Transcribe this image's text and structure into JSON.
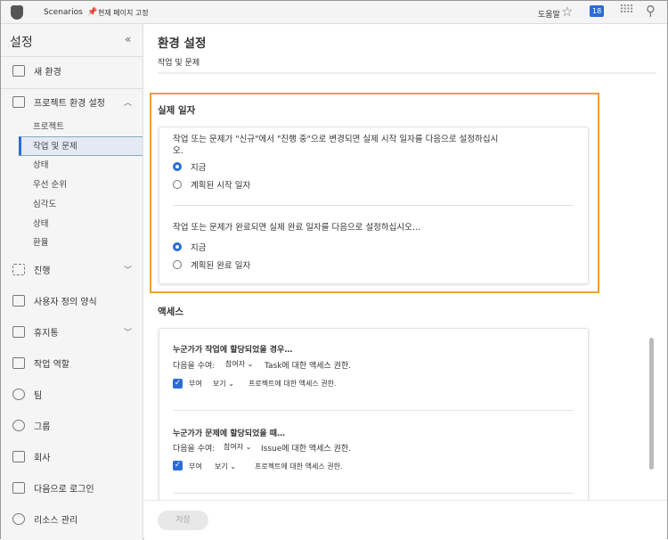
{
  "topbar": {
    "app": "Scenarios",
    "pin": "현재 페이지 고정",
    "help": "도움말",
    "badge": "18"
  },
  "sidebar": {
    "title": "설정",
    "collapse": "«",
    "items": [
      {
        "label": "새 환경"
      },
      {
        "label": "프로젝트 환경 설정"
      },
      {
        "label": "진행"
      },
      {
        "label": "사용자 정의 양식"
      },
      {
        "label": "휴지통"
      },
      {
        "label": "작업 역할"
      },
      {
        "label": "팀"
      },
      {
        "label": "그룹"
      },
      {
        "label": "회사"
      },
      {
        "label": "다음으로 로그인"
      },
      {
        "label": "리소스 관리"
      }
    ],
    "subitems": [
      "프로젝트",
      "작업 및 문제",
      "상태",
      "우선 순위",
      "심각도",
      "상태",
      "환율"
    ]
  },
  "main": {
    "title": "환경 설정",
    "subtitle": "작업 및 문제",
    "actual_dates": {
      "title": "실제 일자",
      "q1": "작업 또는 문제가 \"신규\"에서 \"진행 중\"으로 변경되면 실제 시작 일자를 다음으로 설정하십시오.",
      "q1_options": [
        "지금",
        "계획된 시작 일자"
      ],
      "q2": "작업 또는 문제가 완료되면 실제 완료 일자를 다음으로 설정하십시오…",
      "q2_options": [
        "지금",
        "계획된 완료 일자"
      ]
    },
    "access": {
      "title": "액세스",
      "blocks": [
        {
          "heading": "누군가가 작업에 할당되었을 경우…",
          "grant": "다음을 수여:",
          "role": "참여자",
          "suffix": "Task에 대한 액세스 권한.",
          "check": "부여",
          "level": "보기",
          "proj": "프로젝트에 대한 액세스 권한."
        },
        {
          "heading": "누군가가 문제에 할당되었을 때…",
          "grant": "다음을 수여:",
          "role": "참여자",
          "suffix": "Issue에 대한 액세스 권한.",
          "check": "부여",
          "level": "보기",
          "proj": "프로젝트에 대한 액세스 권한."
        }
      ]
    },
    "save": "저장"
  }
}
